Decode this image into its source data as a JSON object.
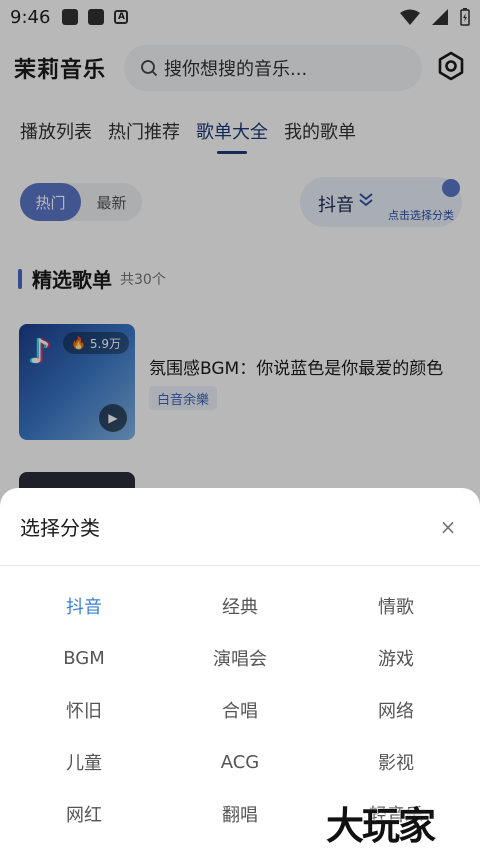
{
  "statusbar": {
    "time": "9:46"
  },
  "appbar": {
    "title": "茉莉音乐",
    "search_placeholder": "搜你想搜的音乐..."
  },
  "tabs": [
    {
      "label": "播放列表"
    },
    {
      "label": "热门推荐"
    },
    {
      "label": "歌单大全"
    },
    {
      "label": "我的歌单"
    }
  ],
  "segment": {
    "hot": "热门",
    "new": "最新"
  },
  "filter": {
    "label": "抖音",
    "hint": "点击选择分类"
  },
  "section": {
    "title": "精选歌单",
    "count": "共30个"
  },
  "playlist": {
    "plays": "5.9万",
    "name": "氛围感BGM：你说蓝色是你最爱的颜色",
    "tag": "白音余樂"
  },
  "sheet": {
    "title": "选择分类",
    "close": "×",
    "categories": [
      "抖音",
      "经典",
      "情歌",
      "BGM",
      "演唱会",
      "游戏",
      "怀旧",
      "合唱",
      "网络",
      "儿童",
      "ACG",
      "影视",
      "网红",
      "翻唱",
      "轻音乐"
    ]
  },
  "watermark": "大玩家",
  "colors": {
    "accent": "#3a82d6",
    "brand": "#5b78c8",
    "tab_active": "#1e3a7a"
  }
}
